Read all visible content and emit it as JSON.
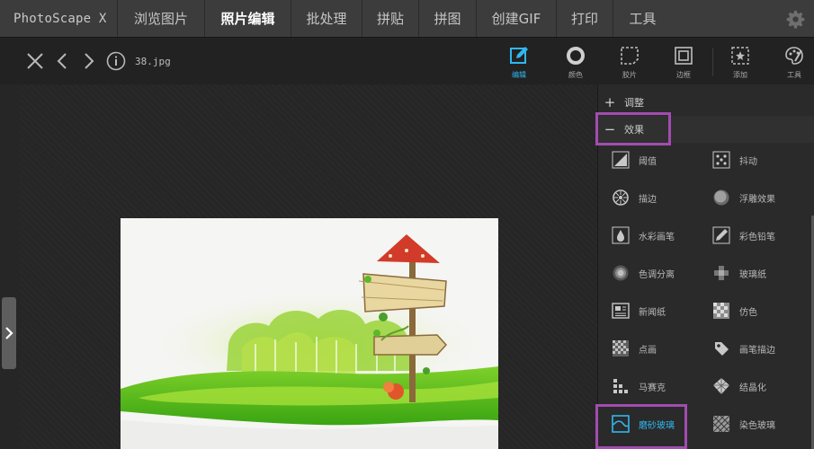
{
  "app": {
    "name": "PhotoScape X"
  },
  "nav": {
    "tabs": [
      {
        "label": "浏览图片"
      },
      {
        "label": "照片编辑"
      },
      {
        "label": "批处理"
      },
      {
        "label": "拼贴"
      },
      {
        "label": "拼图"
      },
      {
        "label": "创建GIF"
      },
      {
        "label": "打印"
      },
      {
        "label": "工具"
      }
    ],
    "active_tab": "照片编辑"
  },
  "toolbar": {
    "filename": "38.jpg",
    "tools": [
      {
        "label": "编辑",
        "icon": "edit-icon",
        "active": true
      },
      {
        "label": "颜色",
        "icon": "color-ring-icon"
      },
      {
        "label": "胶片",
        "icon": "film-icon"
      },
      {
        "label": "边框",
        "icon": "frame-icon"
      },
      {
        "label": "添加",
        "icon": "add-icon"
      },
      {
        "label": "工具",
        "icon": "tools-icon"
      }
    ]
  },
  "panel": {
    "sections": [
      {
        "title": "调整",
        "sign": "+",
        "expanded": false
      },
      {
        "title": "效果",
        "sign": "−",
        "expanded": true
      }
    ],
    "effects": [
      {
        "label": "阈值",
        "icon": "threshold-icon"
      },
      {
        "label": "抖动",
        "icon": "dither-icon"
      },
      {
        "label": "描边",
        "icon": "outline-icon"
      },
      {
        "label": "浮雕效果",
        "icon": "emboss-icon"
      },
      {
        "label": "水彩画笔",
        "icon": "watercolor-icon"
      },
      {
        "label": "彩色铅笔",
        "icon": "color-pencil-icon"
      },
      {
        "label": "色调分离",
        "icon": "posterize-icon"
      },
      {
        "label": "玻璃纸",
        "icon": "cellophane-icon"
      },
      {
        "label": "新闻纸",
        "icon": "newspaper-icon"
      },
      {
        "label": "仿色",
        "icon": "halftone-icon"
      },
      {
        "label": "点画",
        "icon": "stipple-icon"
      },
      {
        "label": "画笔描边",
        "icon": "brush-stroke-icon"
      },
      {
        "label": "马赛克",
        "icon": "mosaic-icon"
      },
      {
        "label": "结晶化",
        "icon": "crystallize-icon"
      },
      {
        "label": "磨砂玻璃",
        "icon": "frosted-glass-icon",
        "selected": true
      },
      {
        "label": "染色玻璃",
        "icon": "stained-glass-icon"
      }
    ]
  },
  "colors": {
    "accent": "#2fb8f0",
    "highlight": "#a24cb0",
    "nav_bg": "#3c3c3c",
    "panel_bg": "#2a2a2a"
  }
}
